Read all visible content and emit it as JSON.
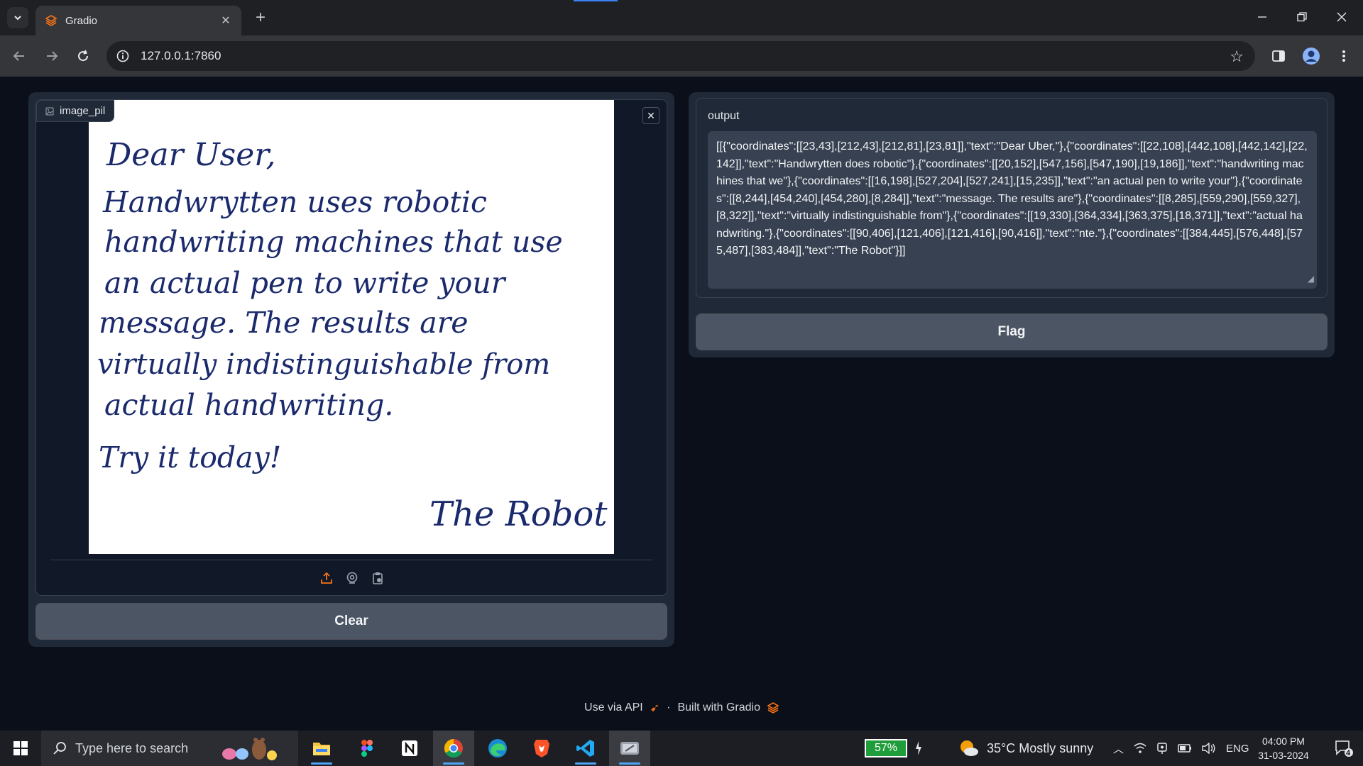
{
  "browser": {
    "tab_title": "Gradio",
    "url": "127.0.0.1:7860"
  },
  "image_input": {
    "label": "image_pil",
    "handwriting_lines": [
      "Dear User,",
      "Handwrytten uses robotic",
      "handwriting machines that use",
      "an actual pen to write your",
      "message. The results are",
      "virtually indistinguishable from",
      "actual handwriting.",
      "Try it today!",
      "The Robot"
    ]
  },
  "buttons": {
    "clear_label": "Clear",
    "flag_label": "Flag"
  },
  "output": {
    "label": "output",
    "text": "[[{\"coordinates\":[[23,43],[212,43],[212,81],[23,81]],\"text\":\"Dear Uber,\"},{\"coordinates\":[[22,108],[442,108],[442,142],[22,142]],\"text\":\"Handwrytten does robotic\"},{\"coordinates\":[[20,152],[547,156],[547,190],[19,186]],\"text\":\"handwriting machines that we\"},{\"coordinates\":[[16,198],[527,204],[527,241],[15,235]],\"text\":\"an actual pen to write your\"},{\"coordinates\":[[8,244],[454,240],[454,280],[8,284]],\"text\":\"message. The results are\"},{\"coordinates\":[[8,285],[559,290],[559,327],[8,322]],\"text\":\"virtually indistinguishable from\"},{\"coordinates\":[[19,330],[364,334],[363,375],[18,371]],\"text\":\"actual handwriting.\"},{\"coordinates\":[[90,406],[121,406],[121,416],[90,416]],\"text\":\"nte.\"},{\"coordinates\":[[384,445],[576,448],[575,487],[383,484]],\"text\":\"The Robot\"}]]"
  },
  "footer": {
    "api_text": "Use via API",
    "separator": "·",
    "built_text": "Built with Gradio"
  },
  "taskbar": {
    "search_placeholder": "Type here to search",
    "battery": "57%",
    "weather": "35°C  Mostly sunny",
    "language": "ENG",
    "time": "04:00 PM",
    "date": "31-03-2024",
    "notification_count": "4"
  }
}
